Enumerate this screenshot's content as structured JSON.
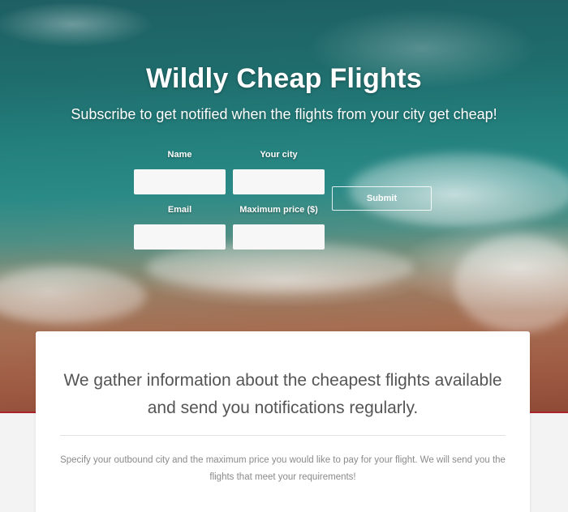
{
  "hero": {
    "title": "Wildly Cheap Flights",
    "subtitle": "Subscribe to get notified when the flights from your city get cheap!"
  },
  "form": {
    "name_label": "Name",
    "city_label": "Your city",
    "email_label": "Email",
    "price_label": "Maximum price ($)",
    "name_value": "",
    "city_value": "",
    "email_value": "",
    "price_value": "",
    "submit_label": "Submit"
  },
  "info": {
    "heading_line1": "We gather information about the cheapest flights available",
    "heading_line2": "and send you notifications regularly.",
    "body": "Specify your outbound city and the maximum price you would like to pay for your flight. We will send you the flights that meet your requirements!"
  },
  "colors": {
    "accent_line": "#a8232a",
    "page_background": "#f3f3f3"
  }
}
